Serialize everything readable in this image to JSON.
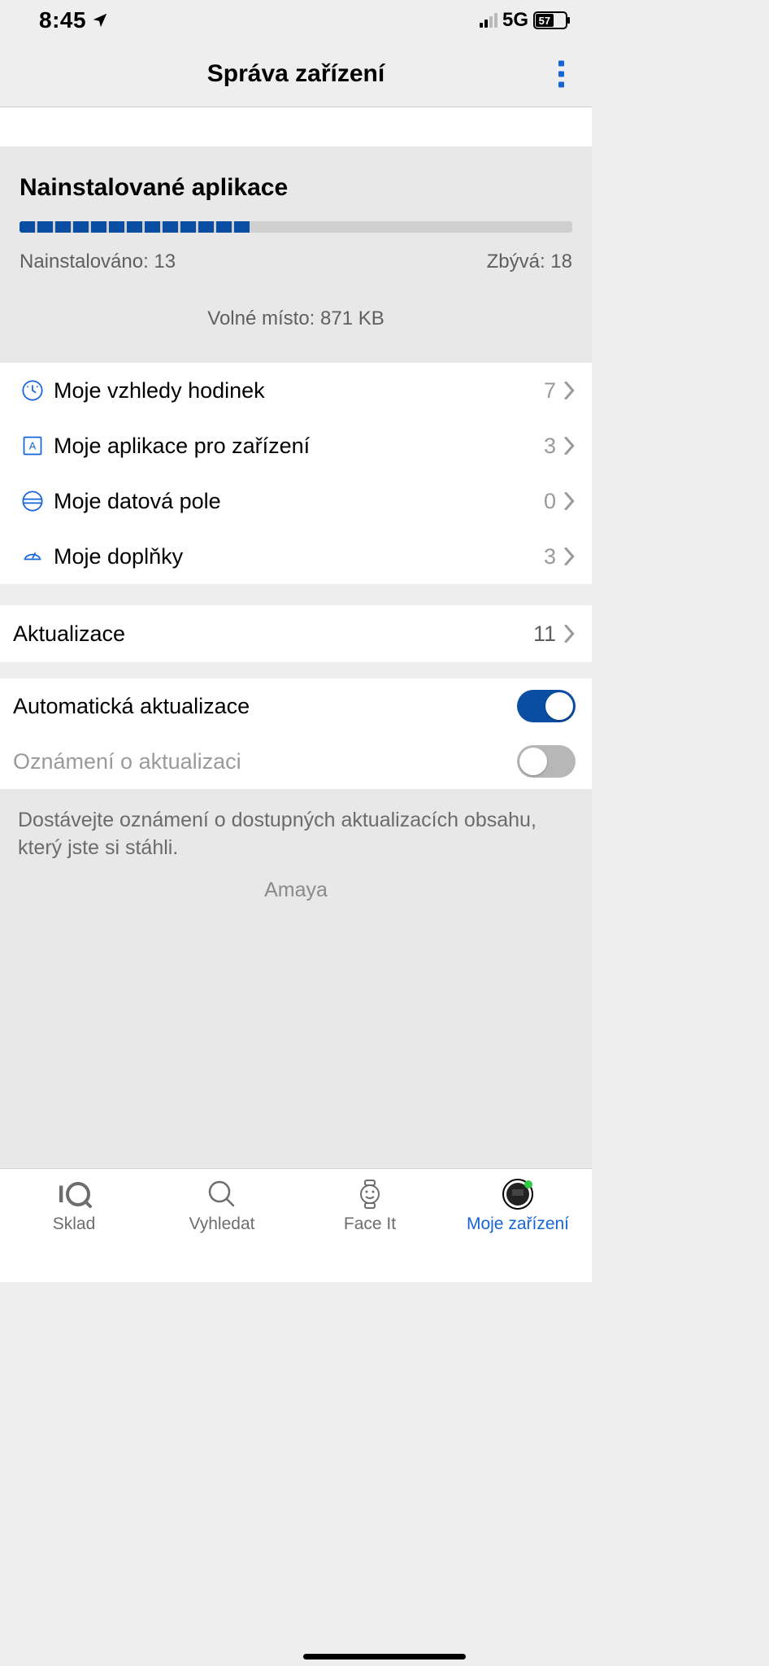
{
  "status": {
    "time": "8:45",
    "network": "5G",
    "battery_text": "57"
  },
  "header": {
    "title": "Správa zařízení"
  },
  "installed": {
    "title": "Nainstalované aplikace",
    "installed_label": "Nainstalováno: 13",
    "remaining_label": "Zbývá: 18",
    "free_space": "Volné místo: 871 KB",
    "segments_filled": 13,
    "segments_total": 31
  },
  "categories": [
    {
      "label": "Moje vzhledy hodinek",
      "count": "7"
    },
    {
      "label": "Moje aplikace pro zařízení",
      "count": "3"
    },
    {
      "label": "Moje datová pole",
      "count": "0"
    },
    {
      "label": "Moje doplňky",
      "count": "3"
    }
  ],
  "updates": {
    "label": "Aktualizace",
    "count": "11"
  },
  "toggles": {
    "auto_update": {
      "label": "Automatická aktualizace",
      "on": true
    },
    "update_notify": {
      "label": "Oznámení o aktualizaci",
      "on": false
    }
  },
  "note": {
    "text": "Dostávejte oznámení o dostupných aktualizacích obsahu, který jste si stáhli.",
    "sub": "Amaya"
  },
  "tabs": [
    {
      "label": "Sklad"
    },
    {
      "label": "Vyhledat"
    },
    {
      "label": "Face It"
    },
    {
      "label": "Moje zařízení"
    }
  ]
}
